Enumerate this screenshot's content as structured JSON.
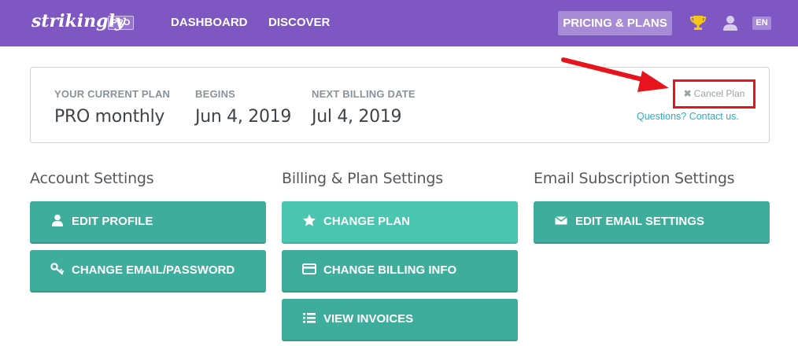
{
  "nav": {
    "logo": "strikingly",
    "badge": "PRO",
    "links": [
      "DASHBOARD",
      "DISCOVER"
    ],
    "pricing": "PRICING & PLANS",
    "lang": "EN",
    "icons": [
      "trophy-icon",
      "user-icon"
    ]
  },
  "plan": {
    "current_label": "YOUR CURRENT PLAN",
    "current_value": "PRO monthly",
    "begins_label": "BEGINS",
    "begins_value": "Jun 4, 2019",
    "next_label": "NEXT BILLING DATE",
    "next_value": "Jul 4, 2019",
    "cancel": "Cancel Plan",
    "questions": "Questions? Contact us."
  },
  "sections": {
    "account": {
      "title": "Account Settings",
      "buttons": [
        "EDIT PROFILE",
        "CHANGE EMAIL/PASSWORD"
      ]
    },
    "billing": {
      "title": "Billing & Plan Settings",
      "buttons": [
        "CHANGE PLAN",
        "CHANGE BILLING INFO",
        "VIEW INVOICES"
      ]
    },
    "email": {
      "title": "Email Subscription Settings",
      "buttons": [
        "EDIT EMAIL SETTINGS"
      ]
    }
  },
  "colors": {
    "nav": "#7e57c2",
    "button": "#3fad9b",
    "button_active": "#4ac5b0",
    "link": "#25b0c5",
    "highlight": "#e8141d"
  }
}
